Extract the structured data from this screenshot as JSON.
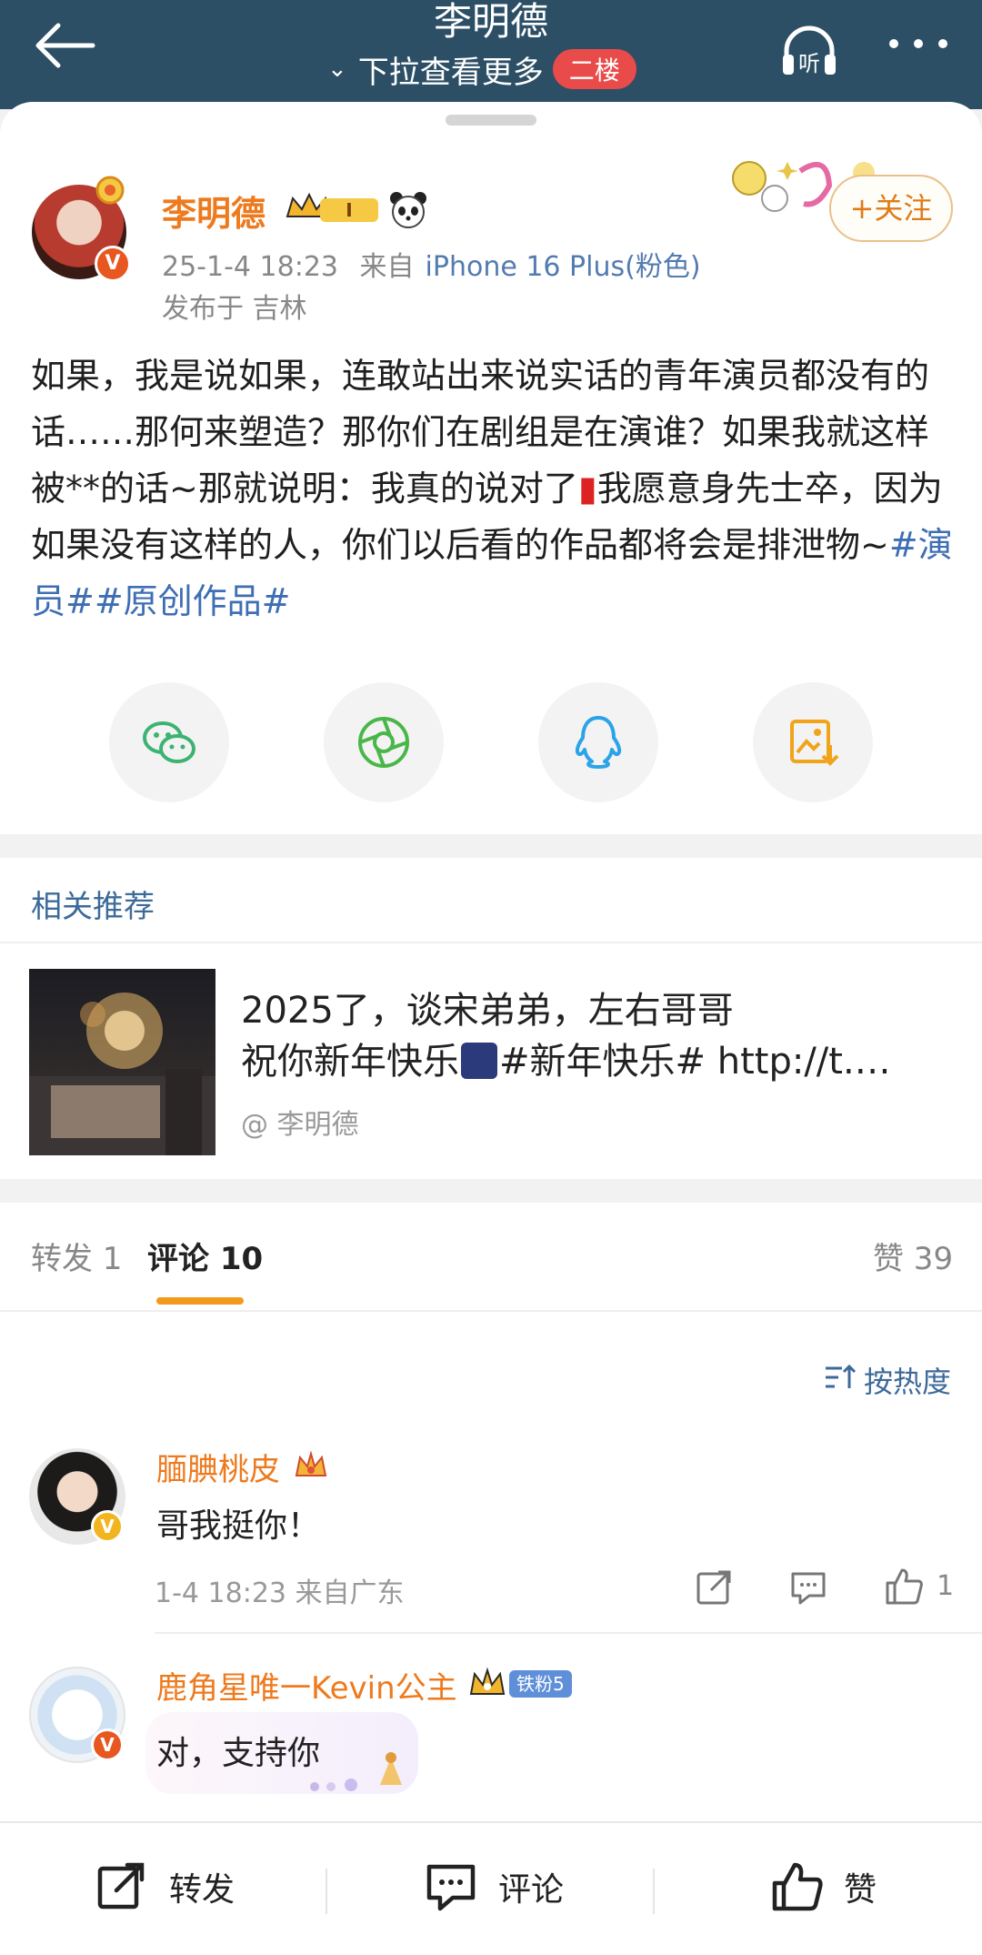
{
  "header": {
    "title": "李明德",
    "subtitle": "下拉查看更多",
    "floor_badge": "二楼",
    "listen_label": "听"
  },
  "post": {
    "author": "李明德",
    "vip_level": "I",
    "time": "25-1-4 18:23",
    "source_prefix": "来自",
    "device": "iPhone 16 Plus(粉色)",
    "location": "发布于 吉林",
    "follow_label": "+关注",
    "text_main": "如果，我是说如果，连敢站出来说实话的青年演员都没有的话……那何来塑造？那你们在剧组是在演谁？如果我就这样被**的话~那就说明：我真的说对了",
    "text_main2": "我愿意身先士卒，因为如果没有这样的人，你们以后看的作品都将会是排泄物~",
    "topic1": "#演员#",
    "topic2": "#原创作品#",
    "candle_emoji": "🧯"
  },
  "share": {
    "items": [
      "wechat",
      "moments",
      "qq",
      "save-image"
    ]
  },
  "related": {
    "title": "相关推荐",
    "line1": "2025了，谈宋弟弟，左右哥哥",
    "line2_text": "祝你新年快乐",
    "line2_emoji": "🎆",
    "line2_topic": "#新年快乐# http://t.…",
    "author": "@ 李明德"
  },
  "tabs": {
    "repost": "转发 1",
    "comments": "评论 10",
    "likes": "赞 39"
  },
  "sort_label": "按热度",
  "comments": [
    {
      "name": "腼腆桃皮",
      "text": "哥我挺你！",
      "meta": "1-4 18:23  来自广东",
      "likes": "1"
    },
    {
      "name": "鹿角星唯一Kevin公主",
      "fan_badge": "铁粉5",
      "text": "对，支持你"
    }
  ],
  "bottom": {
    "repost": "转发",
    "comment": "评论",
    "like": "赞"
  },
  "colors": {
    "header_bg": "#2c4f66",
    "accent_orange": "#ee7a1e",
    "link_blue": "#3e6eb3"
  }
}
